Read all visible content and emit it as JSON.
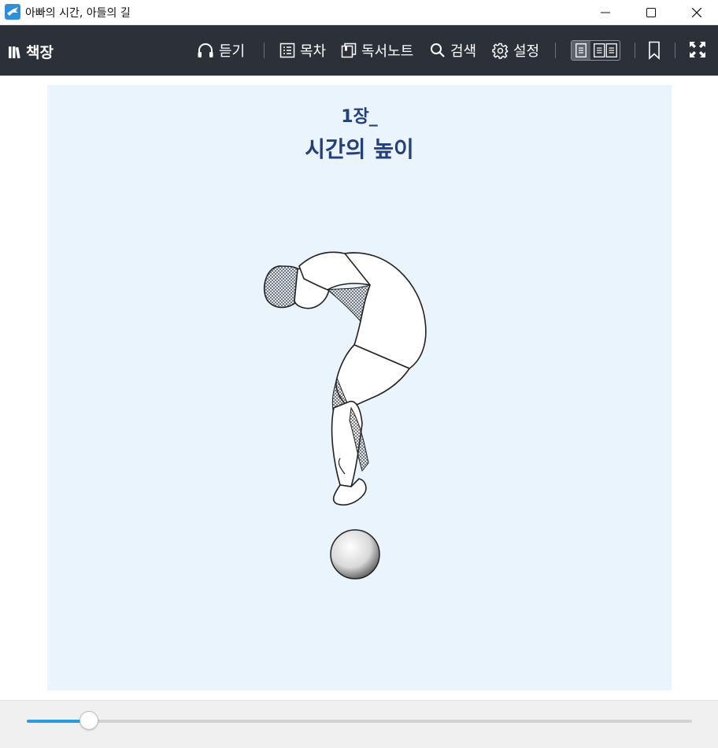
{
  "window": {
    "title": "아빠의 시간, 아들의 길"
  },
  "toolbar": {
    "bookshelf_label": "책장",
    "listen_label": "듣기",
    "toc_label": "목차",
    "notes_label": "독서노트",
    "search_label": "검색",
    "settings_label": "설정",
    "active_view": "single-page"
  },
  "page": {
    "chapter_number": "1장_",
    "chapter_title": "시간의 높이",
    "background_color": "#eaf4fc",
    "title_color": "#24407c"
  },
  "progress": {
    "fraction": 0.093,
    "accent_color": "#2a9be0"
  },
  "icons": [
    "bookshelf-icon",
    "headphones-icon",
    "list-icon",
    "notebook-icon",
    "search-icon",
    "gear-icon",
    "single-page-icon",
    "double-page-icon",
    "bookmark-icon",
    "fullscreen-icon",
    "minimize-icon",
    "maximize-icon",
    "close-icon"
  ]
}
